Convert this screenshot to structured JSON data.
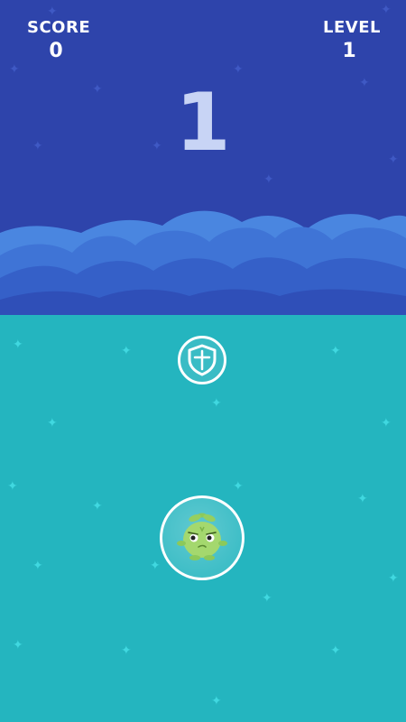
{
  "hud": {
    "score_label": "SCORE",
    "score_value": "0",
    "level_label": "LEVEL",
    "level_value": "1"
  },
  "countdown": "1",
  "powerup": {
    "icon": "shield-icon"
  },
  "player": {
    "icon": "green-creature-icon",
    "in_bubble": true
  },
  "colors": {
    "sky": "#2e44ab",
    "sea": "#24b5bf",
    "cloud_light": "#4a86e0",
    "cloud_dark": "#2f4fb8",
    "creature": "#a4d86e"
  }
}
